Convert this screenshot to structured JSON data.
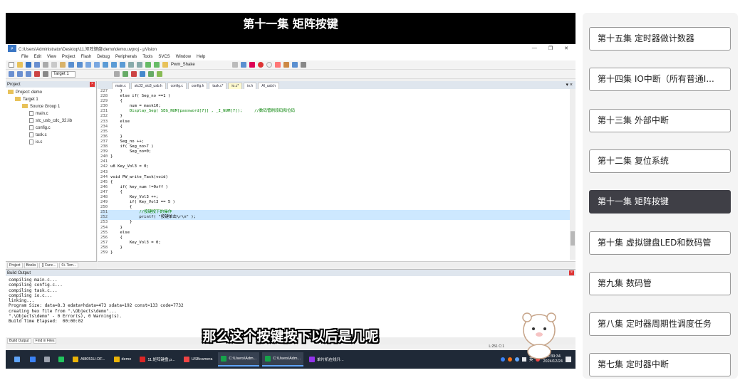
{
  "video": {
    "title": "第十一集 矩阵按键",
    "subtitle": "那么这个按键按下以后是几呢"
  },
  "ide": {
    "window_title": "C:\\Users\\Administrator\\Desktop\\11.矩阵键盘\\demo\\demo.uvproj - µVision",
    "window_controls": [
      "—",
      "❐",
      "✕"
    ],
    "menu": [
      "File",
      "Edit",
      "View",
      "Project",
      "Flash",
      "Debug",
      "Peripherals",
      "Tools",
      "SVCS",
      "Window",
      "Help"
    ],
    "toolbar_combo": "Pwm_Shake",
    "target_combo": "Target 1",
    "project_pane": {
      "title": "Project",
      "tree": [
        {
          "label": "Project: demo",
          "indent": 0,
          "kind": "root"
        },
        {
          "label": "Target 1",
          "indent": 1,
          "kind": "target"
        },
        {
          "label": "Source Group 1",
          "indent": 2,
          "kind": "folder"
        },
        {
          "label": "main.c",
          "indent": 3,
          "kind": "file"
        },
        {
          "label": "stc_usb_cdc_32.lib",
          "indent": 3,
          "kind": "file"
        },
        {
          "label": "config.c",
          "indent": 3,
          "kind": "file"
        },
        {
          "label": "task.c",
          "indent": 3,
          "kind": "file"
        },
        {
          "label": "io.c",
          "indent": 3,
          "kind": "file"
        }
      ],
      "tabs": [
        "Project",
        "Books",
        "{} Func...",
        "0+ Tem..."
      ]
    },
    "editor_tabs": [
      {
        "label": "main.c",
        "active": false
      },
      {
        "label": "stc32_stc8_usb.h",
        "active": false
      },
      {
        "label": "config.c",
        "active": false
      },
      {
        "label": "config.h",
        "active": false
      },
      {
        "label": "task.c*",
        "active": false
      },
      {
        "label": "io.c*",
        "active": true
      },
      {
        "label": "io.h",
        "active": false
      },
      {
        "label": "AI_usb.h",
        "active": false
      }
    ],
    "code_lines": [
      {
        "n": "227",
        "t": "    }"
      },
      {
        "n": "228",
        "t": "    else if( Seg_no ==1 )"
      },
      {
        "n": "229",
        "t": "    {"
      },
      {
        "n": "230",
        "t": "        num = mask10;"
      },
      {
        "n": "231",
        "t": "        Display_Seg( SEG_NUM[password[7]] , _I_NUM[7]);     //数码管刷段码和位码"
      },
      {
        "n": "232",
        "t": "    }"
      },
      {
        "n": "233",
        "t": "    else"
      },
      {
        "n": "234",
        "t": "    {"
      },
      {
        "n": "235",
        "t": ""
      },
      {
        "n": "236",
        "t": "    }"
      },
      {
        "n": "237",
        "t": "    Seg_no ++;"
      },
      {
        "n": "238",
        "t": "    if( Seg_no>7 )"
      },
      {
        "n": "239",
        "t": "        Seg_no=0;"
      },
      {
        "n": "240",
        "t": "}"
      },
      {
        "n": "241",
        "t": ""
      },
      {
        "n": "242",
        "t": "u8 Key_Vol3 = 0;"
      },
      {
        "n": "243",
        "t": ""
      },
      {
        "n": "244",
        "t": "void PW_write_Task(void)"
      },
      {
        "n": "245",
        "t": "{"
      },
      {
        "n": "246",
        "t": "    if( key_num !=0xff )"
      },
      {
        "n": "247",
        "t": "    {"
      },
      {
        "n": "248",
        "t": "        Key_Vol3 ++;"
      },
      {
        "n": "249",
        "t": "        if( Key_Vol3 == 5 )"
      },
      {
        "n": "250",
        "t": "        {"
      },
      {
        "n": "251",
        "t": "            //按键按下的操作"
      },
      {
        "n": "252",
        "t": "            printf( \"按键单击\\r\\n\" );"
      },
      {
        "n": "253",
        "t": "        }"
      },
      {
        "n": "254",
        "t": "    }"
      },
      {
        "n": "255",
        "t": "    else"
      },
      {
        "n": "256",
        "t": "    {"
      },
      {
        "n": "257",
        "t": "        Key_Vol3 = 0;"
      },
      {
        "n": "258",
        "t": "    }"
      },
      {
        "n": "259",
        "t": "}"
      }
    ],
    "build_output": {
      "title": "Build Output",
      "text": "compiling main.c...\ncompiling config.c...\ncompiling task.c...\ncompiling io.c...\nlinking...\nProgram Size: data=8.3 edata+hdata=473 xdata=192 const=133 code=7732\ncreating hex file from \".\\Objects\\demo\"...\n\".\\Objects\\demo\" - 0 Error(s), 0 Warning(s).\nBuild Time Elapsed:  00:00:02",
      "tabs": [
        "Build Output",
        "Find in Files"
      ]
    },
    "status_position": "L:251 C:1"
  },
  "taskbar": {
    "items": [
      {
        "label": "",
        "color": "#3b82f6"
      },
      {
        "label": "",
        "color": "#9ca3af"
      },
      {
        "label": "",
        "color": "#22c55e"
      },
      {
        "label": "AI8051U-DF...",
        "color": "#eab308"
      },
      {
        "label": "demo",
        "color": "#eab308"
      },
      {
        "label": "11.矩阵键盘.p...",
        "color": "#dc2626"
      },
      {
        "label": "USBcamera",
        "color": "#ef4444"
      },
      {
        "label": "C:\\Users\\Adm...",
        "color": "#16a34a"
      },
      {
        "label": "C:\\Users\\Adm...",
        "color": "#16a34a"
      },
      {
        "label": "单片机在线升...",
        "color": "#9333ea"
      }
    ],
    "tray_text": "英",
    "time": "23:39:34",
    "date": "2024/12/24"
  },
  "playlist": [
    {
      "label": "第十五集 定时器做计数器",
      "active": false
    },
    {
      "label": "第十四集 IO中断（所有普通I...",
      "active": false
    },
    {
      "label": "第十三集 外部中断",
      "active": false
    },
    {
      "label": "第十二集 复位系统",
      "active": false
    },
    {
      "label": "第十一集 矩阵按键",
      "active": true
    },
    {
      "label": "第十集 虚拟键盘LED和数码管",
      "active": false
    },
    {
      "label": "第九集 数码管",
      "active": false
    },
    {
      "label": "第八集 定时器周期性调度任务",
      "active": false
    },
    {
      "label": "第七集 定时器中断",
      "active": false
    }
  ]
}
